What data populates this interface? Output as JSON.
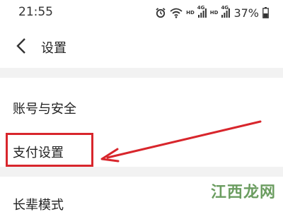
{
  "status_bar": {
    "time": "21:55",
    "hd_label": "HD",
    "network_label": "4G",
    "battery_percent": "37%",
    "icons": [
      "alarm-icon",
      "wifi-icon",
      "signal-icon",
      "battery-icon"
    ]
  },
  "header": {
    "back_icon": "chevron-left-icon",
    "title": "设置"
  },
  "settings_items": [
    {
      "label": "账号与安全"
    },
    {
      "label": "支付设置"
    },
    {
      "label": "长辈模式"
    }
  ],
  "annotation": {
    "highlight_color": "#d8262c",
    "arrow_color": "#d8262c"
  },
  "watermark": "江西龙网"
}
